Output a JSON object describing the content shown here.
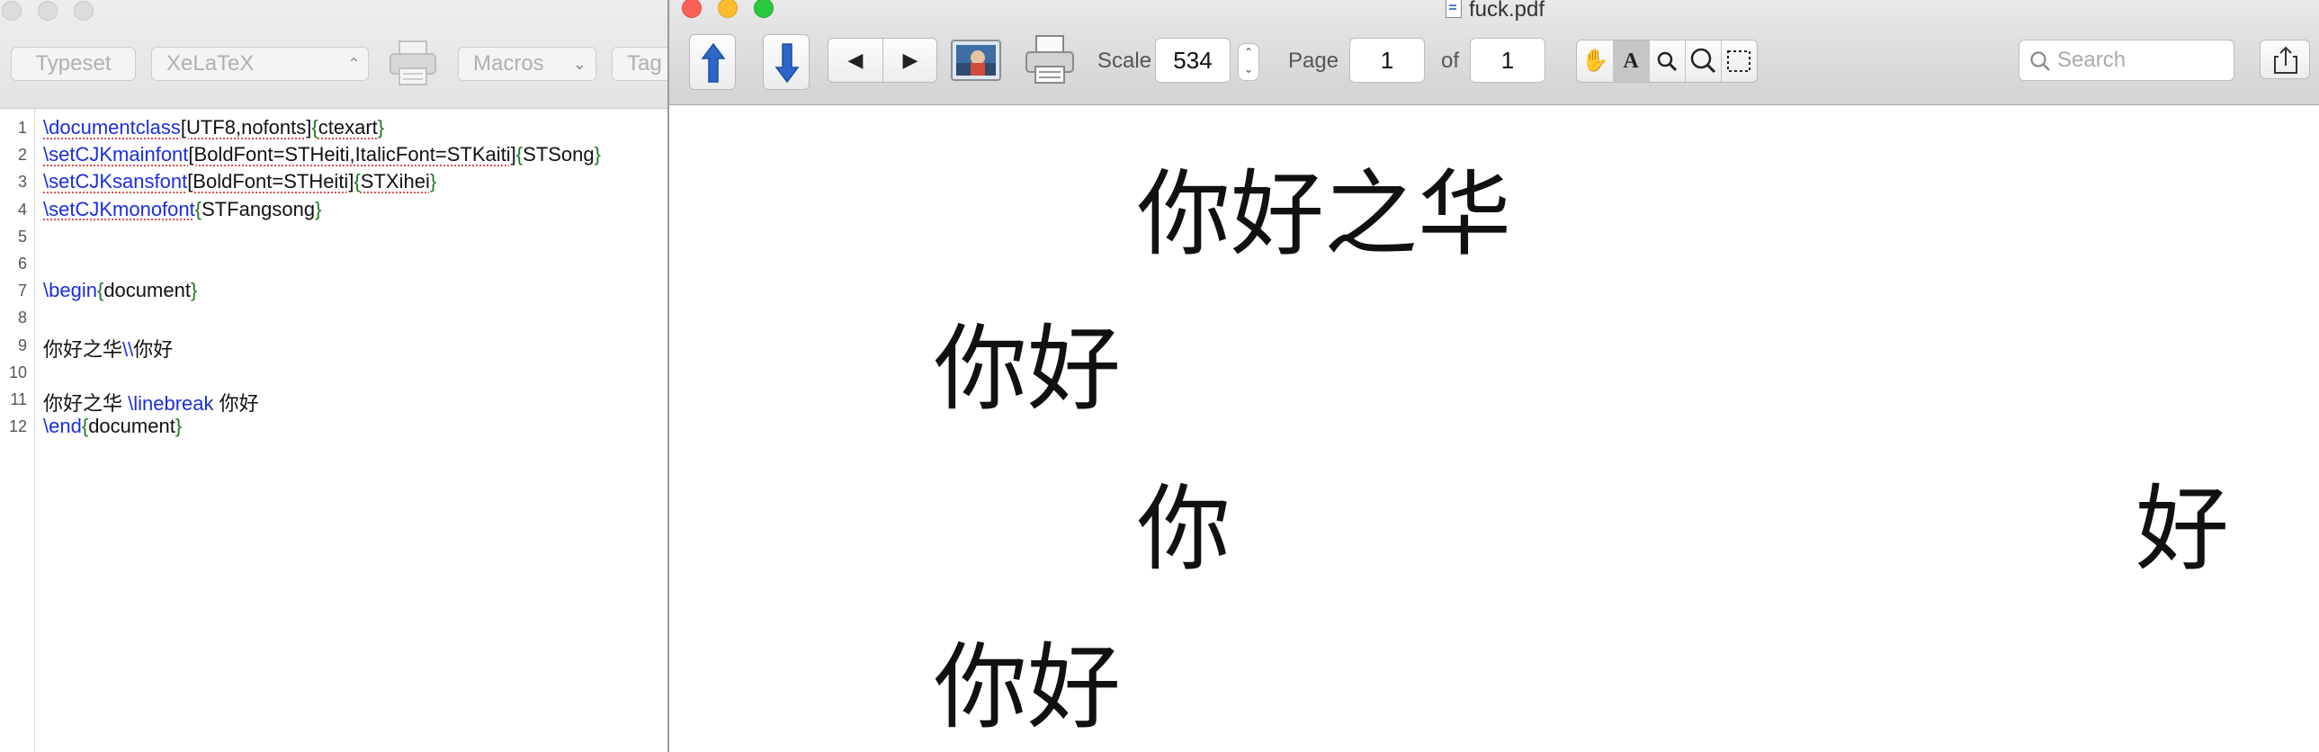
{
  "editor": {
    "toolbar": {
      "typeset_label": "Typeset",
      "engine_value": "XeLaTeX",
      "macros_label": "Macros",
      "tags_label": "Tag"
    },
    "lines": [
      {
        "num": "1",
        "parts": [
          {
            "t": "\\documentclass",
            "c": "cmd",
            "sq": true
          },
          {
            "t": "[UTF8,nofonts]",
            "c": "plain",
            "sq": true
          },
          {
            "t": "{",
            "c": "brace"
          },
          {
            "t": "ctexart",
            "c": "plain",
            "sq": true
          },
          {
            "t": "}",
            "c": "brace"
          }
        ]
      },
      {
        "num": "2",
        "parts": [
          {
            "t": "\\setCJKmainfont",
            "c": "cmd",
            "sq": true
          },
          {
            "t": "[BoldFont=STHeiti,ItalicFont=STKaiti]",
            "c": "plain",
            "sq": true
          },
          {
            "t": "{",
            "c": "brace"
          },
          {
            "t": "STSong",
            "c": "plain"
          },
          {
            "t": "}",
            "c": "brace"
          }
        ]
      },
      {
        "num": "3",
        "parts": [
          {
            "t": "\\setCJKsansfont",
            "c": "cmd",
            "sq": true
          },
          {
            "t": "[BoldFont=STHeiti]",
            "c": "plain",
            "sq": true
          },
          {
            "t": "{",
            "c": "brace"
          },
          {
            "t": "STXihei",
            "c": "plain",
            "sq": true
          },
          {
            "t": "}",
            "c": "brace"
          }
        ]
      },
      {
        "num": "4",
        "parts": [
          {
            "t": "\\setCJKmonofont",
            "c": "cmd",
            "sq": true
          },
          {
            "t": "{",
            "c": "brace"
          },
          {
            "t": "STFangsong",
            "c": "plain"
          },
          {
            "t": "}",
            "c": "brace"
          }
        ]
      },
      {
        "num": "5",
        "parts": []
      },
      {
        "num": "6",
        "parts": []
      },
      {
        "num": "7",
        "parts": [
          {
            "t": "\\begin",
            "c": "cmd"
          },
          {
            "t": "{",
            "c": "brace"
          },
          {
            "t": "document",
            "c": "plain"
          },
          {
            "t": "}",
            "c": "brace"
          }
        ]
      },
      {
        "num": "8",
        "parts": []
      },
      {
        "num": "9",
        "parts": [
          {
            "t": "你好之华",
            "c": "plain"
          },
          {
            "t": "\\\\",
            "c": "cmd"
          },
          {
            "t": "你好",
            "c": "plain"
          }
        ]
      },
      {
        "num": "10",
        "parts": []
      },
      {
        "num": "11",
        "parts": [
          {
            "t": "你好之华 ",
            "c": "plain"
          },
          {
            "t": "\\linebreak",
            "c": "cmd"
          },
          {
            "t": " 你好",
            "c": "plain"
          }
        ]
      },
      {
        "num": "12",
        "parts": [
          {
            "t": "\\end",
            "c": "cmd"
          },
          {
            "t": "{",
            "c": "brace"
          },
          {
            "t": "document",
            "c": "plain"
          },
          {
            "t": "}",
            "c": "brace"
          }
        ]
      }
    ]
  },
  "pdf": {
    "window_title": "fuck.pdf",
    "toolbar": {
      "scale_label": "Scale",
      "scale_value": "534",
      "page_label": "Page",
      "page_value": "1",
      "of_label": "of",
      "page_count": "1",
      "search_placeholder": "Search"
    },
    "page_lines": {
      "line1": "你好之华",
      "line2": "你好",
      "line3_left": "你",
      "line3_right": "好",
      "line4": "你好"
    }
  }
}
